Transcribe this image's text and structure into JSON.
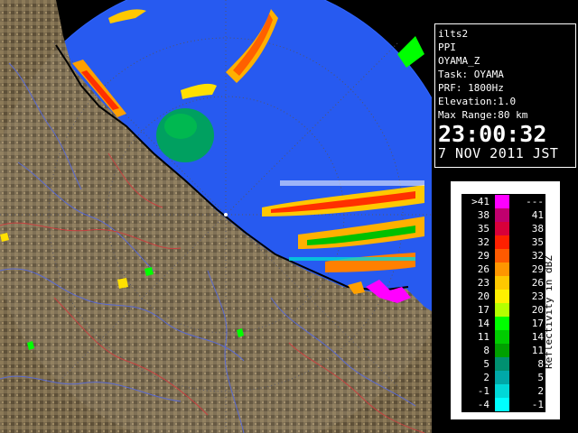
{
  "info": {
    "product": "ilts2",
    "mode": "PPI",
    "variable": "OYAMA_Z",
    "task": "Task: OYAMA",
    "prf": "PRF: 1800Hz",
    "elevation": "Elevation:1.0",
    "max_range": "Max Range:80 km",
    "time": "23:00:32",
    "date": "7 NOV 2011 JST"
  },
  "legend": {
    "unit": "Reflectivity in dBZ",
    "rows": [
      {
        "low": ">41",
        "high": "---",
        "color": "#ff00ff"
      },
      {
        "low": "38",
        "high": "41",
        "color": "#c0006e"
      },
      {
        "low": "35",
        "high": "38",
        "color": "#d8003a"
      },
      {
        "low": "32",
        "high": "35",
        "color": "#ff2000"
      },
      {
        "low": "29",
        "high": "32",
        "color": "#ff5a00"
      },
      {
        "low": "26",
        "high": "29",
        "color": "#ff9600"
      },
      {
        "low": "23",
        "high": "26",
        "color": "#ffc800"
      },
      {
        "low": "20",
        "high": "23",
        "color": "#fff000"
      },
      {
        "low": "17",
        "high": "20",
        "color": "#b4ff00"
      },
      {
        "low": "14",
        "high": "17",
        "color": "#00ff00"
      },
      {
        "low": "11",
        "high": "14",
        "color": "#00cc00"
      },
      {
        "low": "8",
        "high": "11",
        "color": "#00a000"
      },
      {
        "low": "5",
        "high": "8",
        "color": "#009070"
      },
      {
        "low": "2",
        "high": "5",
        "color": "#00a8a8"
      },
      {
        "low": "-1",
        "high": "2",
        "color": "#00d8d8"
      },
      {
        "low": "-4",
        "high": "-1",
        "color": "#00ffff"
      }
    ]
  },
  "colors": {
    "range_disk": "#1a50f0",
    "land": "#7d6b4c",
    "ocean_out": "#000000"
  }
}
